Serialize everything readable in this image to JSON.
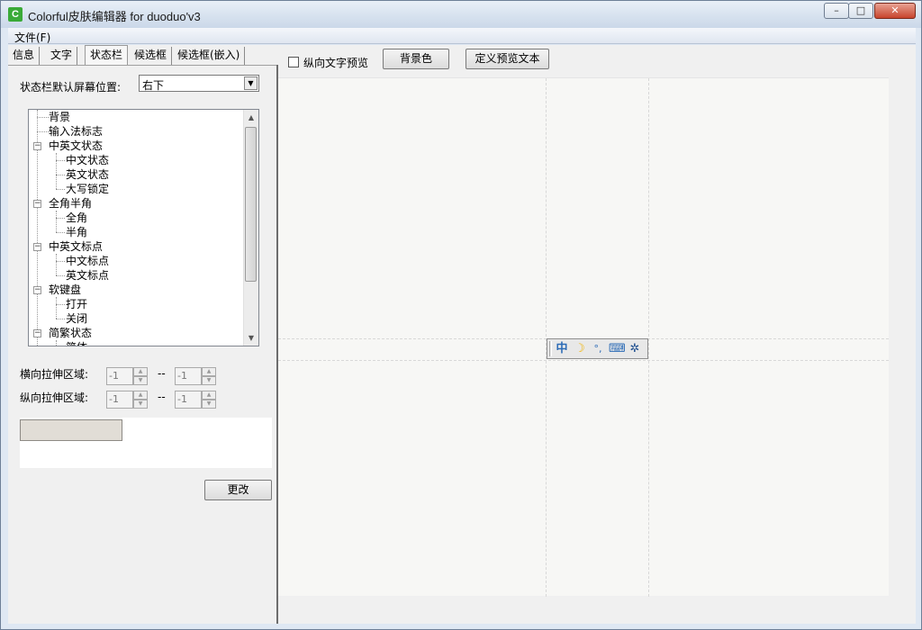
{
  "window": {
    "title": "Colorful皮肤编辑器 for duoduo'v3",
    "icon": "C"
  },
  "title_buttons": {
    "minimize": "–",
    "maximize": "□",
    "close": "✕"
  },
  "menu": {
    "file": "文件(F)"
  },
  "tabs": [
    "信息",
    "文字",
    "状态栏",
    "候选框",
    "候选框(嵌入)"
  ],
  "active_tab": "状态栏",
  "left": {
    "position_label": "状态栏默认屏幕位置:",
    "position_value": "右下",
    "tree_items": [
      "背景",
      "输入法标志",
      "中英文状态",
      "中文状态",
      "英文状态",
      "大写锁定",
      "全角半角",
      "全角",
      "半角",
      "中英文标点",
      "中文标点",
      "英文标点",
      "软键盘",
      "打开",
      "关闭",
      "简繁状态",
      "简体"
    ],
    "h_stretch_label": "横向拉伸区域:",
    "v_stretch_label": "纵向拉伸区域:",
    "h_from": "-1",
    "h_to": "-1",
    "v_from": "-1",
    "v_to": "-1",
    "range_sep": "--",
    "change_button": "更改"
  },
  "right": {
    "vertical_preview_label": "纵向文字预览",
    "vertical_preview_checked": false,
    "bg_color_button": "背景色",
    "define_text_button": "定义预览文本"
  },
  "statusbar_icons": [
    "中",
    "☽",
    "°,",
    "⌨",
    "✲"
  ],
  "colors": {
    "accent": "#3aaa38",
    "status_icon_blue": "#2c6bb6",
    "moon": "#f2b400"
  }
}
